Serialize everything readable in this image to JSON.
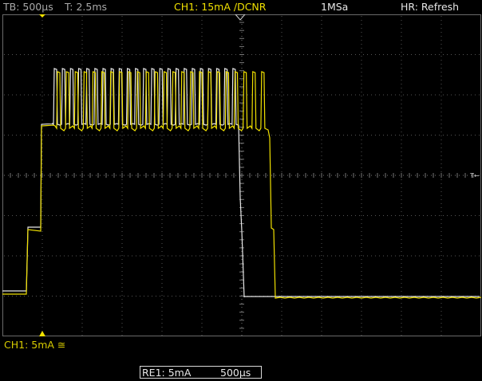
{
  "header": {
    "timebase": "TB: 500µs",
    "trigger_time": "T: 2.5ms",
    "channel": "CH1: 15mA ∕DCNR",
    "sample_rate": "1MSa",
    "hr_mode": "HR: Refresh"
  },
  "trigger_marker": "T←",
  "footer": {
    "ch1_scale": "CH1: 5mA ≅",
    "ref_label": "RE1: 5mA",
    "ref_timebase": "500µs"
  },
  "colors": {
    "channel1": "#f0e000",
    "reference": "#e8e8e8",
    "grid": "#5a5a5a",
    "background": "#000000"
  }
}
